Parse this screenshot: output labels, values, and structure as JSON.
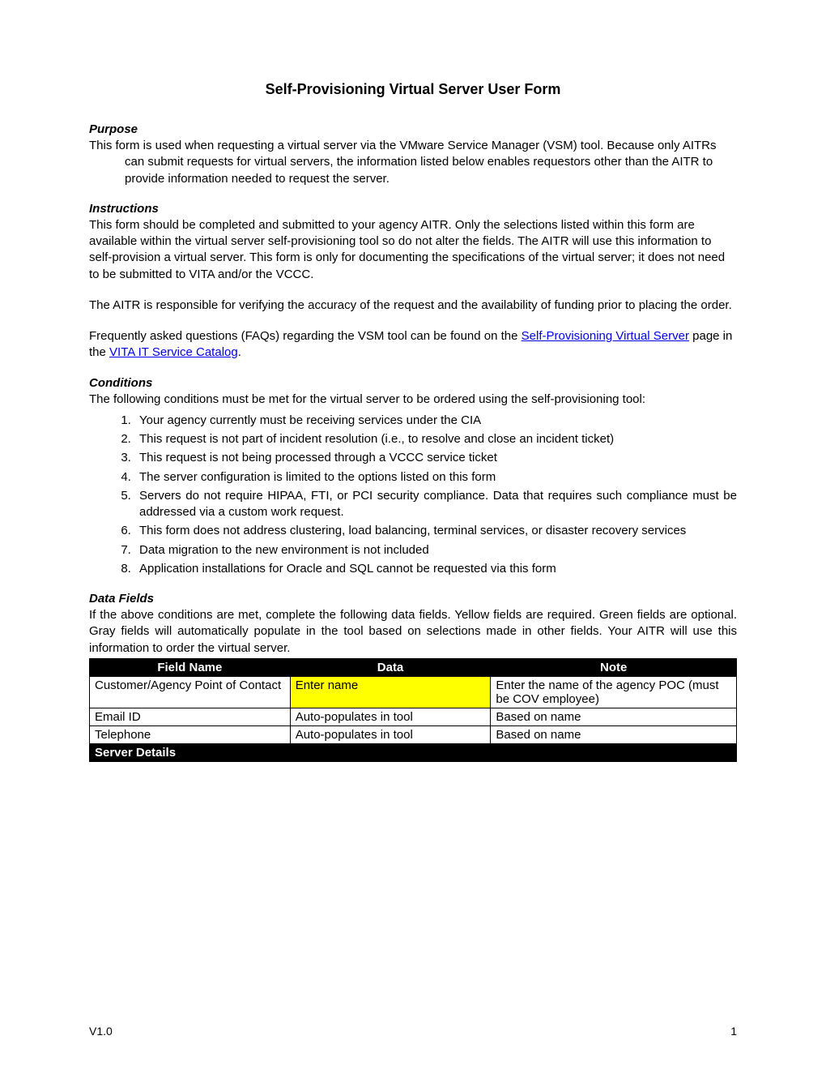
{
  "title": "Self-Provisioning Virtual Server User Form",
  "purpose": {
    "heading": "Purpose",
    "text": "This form is used when requesting a virtual server via the VMware Service Manager (VSM) tool. Because only AITRs can submit requests for virtual servers, the information listed below enables requestors other than the AITR to provide information needed to request the server."
  },
  "instructions": {
    "heading": "Instructions",
    "para1": "This form should be completed and submitted to your agency AITR. Only the selections listed within this form are available within the virtual server self-provisioning tool so do not alter the fields. The AITR will use this information to self-provision a virtual server. This form is only for documenting the specifications of the virtual server; it does not need to be submitted to VITA and/or the VCCC.",
    "para2": "The AITR is responsible for verifying the accuracy of the request and the availability of funding prior to placing the order.",
    "faq_pre": "Frequently asked questions (FAQs) regarding the VSM tool can be found on the ",
    "link1": "Self-Provisioning Virtual Server",
    "faq_mid": " page in the ",
    "link2": "VITA IT Service Catalog",
    "faq_post": "."
  },
  "conditions": {
    "heading": "Conditions",
    "intro": "The following conditions must be met for the virtual server to be ordered using the self-provisioning tool:",
    "items": [
      "Your agency currently must be receiving services under the CIA",
      "This request is not part of incident resolution (i.e., to resolve and close an incident ticket)",
      "This request is not being processed through a VCCC service ticket",
      "The server configuration is limited to the options listed on this form",
      "Servers do not require HIPAA, FTI, or PCI security compliance. Data that requires such compliance must be addressed via a custom work request.",
      "This form does not address clustering, load balancing, terminal services, or disaster recovery services",
      "Data migration to the new environment is not included",
      "Application installations for Oracle and SQL cannot be requested via this form"
    ]
  },
  "datafields": {
    "heading": "Data Fields",
    "intro": "If the above conditions are met, complete the following data fields. Yellow fields are required. Green fields are optional. Gray fields will automatically populate in the tool based on selections made in other fields. Your AITR will use this information to order the virtual server.",
    "columns": [
      "Field Name",
      "Data",
      "Note"
    ],
    "rows": [
      {
        "field": "Customer/Agency Point of Contact",
        "data": "Enter name",
        "note": "Enter the name of the agency POC (must be COV employee)",
        "style": "yellow"
      },
      {
        "field": "Email ID",
        "data": "Auto-populates in tool",
        "note": "Based on name",
        "style": ""
      },
      {
        "field": "Telephone",
        "data": "Auto-populates in tool",
        "note": "Based on name",
        "style": ""
      }
    ],
    "section_row": "Server Details"
  },
  "footer": {
    "version": "V1.0",
    "page": "1"
  }
}
